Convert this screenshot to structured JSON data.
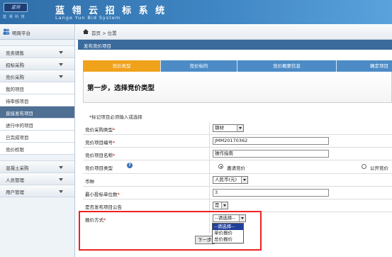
{
  "brand": {
    "logo_text": "蓝翎",
    "logo_sub": "蓝 翎 科 技",
    "title": "蓝 翎 云 招 标 系 统",
    "subtitle": "Lange  Yun   Bid   System"
  },
  "sidebar": {
    "header": "明周平台",
    "items": [
      {
        "label": "竞卖销售",
        "type": "group"
      },
      {
        "label": "招标采购",
        "type": "group"
      },
      {
        "label": "竞价采购",
        "type": "group"
      },
      {
        "label": "我的项目",
        "type": "sub"
      },
      {
        "label": "待审核项目",
        "type": "sub"
      },
      {
        "label": "直接发布项目",
        "type": "active"
      },
      {
        "label": "进行中的项目",
        "type": "sub"
      },
      {
        "label": "已完成项目",
        "type": "sub"
      },
      {
        "label": "竞价权限",
        "type": "sub"
      },
      {
        "label": "混凝土采购",
        "type": "group"
      },
      {
        "label": "人员管理",
        "type": "group"
      },
      {
        "label": "用户管理",
        "type": "group"
      }
    ]
  },
  "breadcrumb": "首页 > 位置",
  "panel_title": "发布竞价项目",
  "steps": [
    "竞价类型",
    "竞价标的",
    "竞价概要信息",
    "确定项目"
  ],
  "step_heading": "第一步，选择竞价类型",
  "note": "*标记项目必须输入或选择",
  "form": {
    "purchase_type": {
      "label": "竞价采购类型",
      "value": "钢材"
    },
    "project_no": {
      "label": "竞价项目编号",
      "value": "JMM20170362"
    },
    "project_name": {
      "label": "竞价项目名称",
      "value": "操作指南"
    },
    "project_type": {
      "label": "竞价项目类型",
      "option1": "邀请竞价",
      "option2": "公开竞价"
    },
    "currency": {
      "label": "币种",
      "value": "人民币(元)"
    },
    "min_bidders": {
      "label": "最小投标单位数",
      "value": "3"
    },
    "announce": {
      "label": "是否发布项目公告",
      "value": "是"
    },
    "quote_method": {
      "label": "报价方式",
      "value": "--请选择--"
    }
  },
  "dropdown_options": [
    "--请选择--",
    "单价报价",
    "总价报价"
  ],
  "next_button": "下一步",
  "colors": {
    "banner": "#3f86c4",
    "active_step": "#f0a21b",
    "highlight": "#e22222",
    "panel": "#3b6a9c"
  }
}
